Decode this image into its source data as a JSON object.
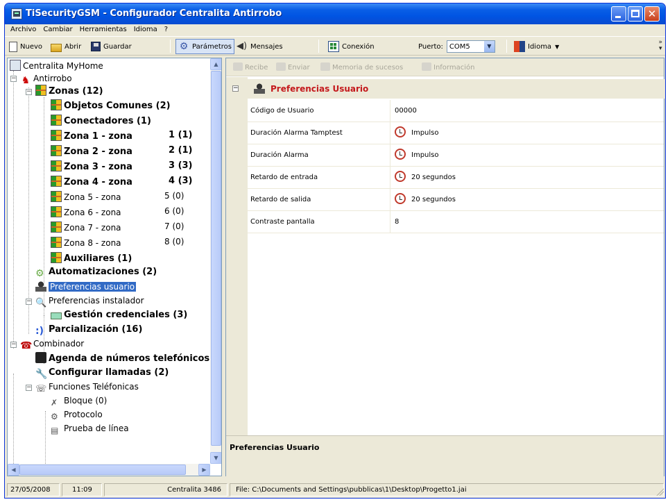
{
  "window": {
    "title": "TiSecurityGSM - Configurador Centralita Antirrobo"
  },
  "menu": [
    "Archivo",
    "Cambiar",
    "Herramientas",
    "Idioma",
    "?"
  ],
  "toolbar": {
    "nuevo": "Nuevo",
    "abrir": "Abrir",
    "guardar": "Guardar",
    "parametros": "Parámetros",
    "mensajes": "Mensajes",
    "conexion": "Conexión",
    "puerto_label": "Puerto:",
    "puerto_value": "COM5",
    "idioma": "Idioma"
  },
  "tree": {
    "root": "Centralita MyHome",
    "antirrobo": "Antirrobo",
    "zonas": "Zonas (12)",
    "objetos": "Objetos Comunes (2)",
    "conectadores": "Conectadores (1)",
    "zones": [
      {
        "label": "Zona 1 - zona",
        "count": "1 (1)"
      },
      {
        "label": "Zona 2 - zona",
        "count": "2 (1)"
      },
      {
        "label": "Zona 3 - zona",
        "count": "3 (3)"
      },
      {
        "label": "Zona 4 - zona",
        "count": "4 (3)"
      },
      {
        "label": "Zona 5 - zona",
        "count": "5 (0)"
      },
      {
        "label": "Zona 6 - zona",
        "count": "6 (0)"
      },
      {
        "label": "Zona 7 - zona",
        "count": "7 (0)"
      },
      {
        "label": "Zona 8 - zona",
        "count": "8 (0)"
      }
    ],
    "auxiliares": "Auxiliares (1)",
    "automatizaciones": "Automatizaciones (2)",
    "pref_usuario": "Preferencias usuario",
    "pref_instalador": "Preferencias instalador",
    "gestion": "Gestión credenciales (3)",
    "parcializacion": "Parcialización (16)",
    "combinador": "Combinador",
    "agenda": "Agenda de números telefónicos",
    "configurar": "Configurar llamadas (2)",
    "funciones": "Funciones Teléfonicas",
    "bloque": "Bloque (0)",
    "protocolo": "Protocolo",
    "prueba": "Prueba de línea"
  },
  "right_toolbar": {
    "recibe": "Recibe",
    "enviar": "Enviar",
    "memoria": "Memoria de sucesos",
    "informacion": "Información"
  },
  "section": {
    "title": "Preferencias Usuario"
  },
  "properties": [
    {
      "name": "Código de Usuario",
      "value": "00000",
      "icon": false
    },
    {
      "name": "Duración Alarma Tamptest",
      "value": "Impulso",
      "icon": true
    },
    {
      "name": "Duración Alarma",
      "value": "Impulso",
      "icon": true
    },
    {
      "name": "Retardo de entrada",
      "value": "20 segundos",
      "icon": true
    },
    {
      "name": "Retardo de salida",
      "value": "20 segundos",
      "icon": true
    },
    {
      "name": "Contraste pantalla",
      "value": "8",
      "icon": false
    }
  ],
  "description": {
    "title": "Preferencias Usuario"
  },
  "status": {
    "date": "27/05/2008",
    "time": "11:09",
    "device": "Centralita 3486",
    "file": "File: C:\\Documents and Settings\\pubblicas\\1\\Desktop\\Progetto1.jai"
  }
}
